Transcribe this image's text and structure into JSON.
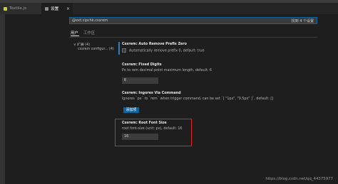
{
  "tabs": [
    {
      "label": "Textile.js",
      "icon_color": "#cbcb41"
    },
    {
      "label": "设置",
      "icon_color": "#8f8f8f"
    }
  ],
  "search": {
    "value": "@ext:cipchk.cssrem",
    "result_count": "找到 4 个设置"
  },
  "scopes": {
    "user": "用户",
    "workspace": "工作区"
  },
  "toc": {
    "group": "∨ 扩展 (4)",
    "item": "cssrem configur... (4)"
  },
  "settings": {
    "auto_remove": {
      "title": "Cssrem: Auto Remove Prefix Zero",
      "description": "Automatically remove prefix 0, default: true"
    },
    "fixed_digits": {
      "title": "Cssrem: Fixed Digits",
      "description": "Px to rem decimal point maximum length, default: 6",
      "value": "6"
    },
    "ingores": {
      "title": "Cssrem: Ingores Via Command",
      "description": "Ignores `px` to `rem` when trigger command, can be set `[ \"1px\", \"0.5px\" ]`, default: []",
      "button": "添加项"
    },
    "root_font_size": {
      "title": "Cssrem: Root Font Size",
      "description": "root font-size (unit: px), default: 16",
      "value": "16"
    }
  },
  "watermark": "https://blog.csdn.net/qq_44375977",
  "colors": {
    "highlight_border": "#e02424",
    "accent": "#0e639c",
    "focus": "#2e7ec3"
  }
}
